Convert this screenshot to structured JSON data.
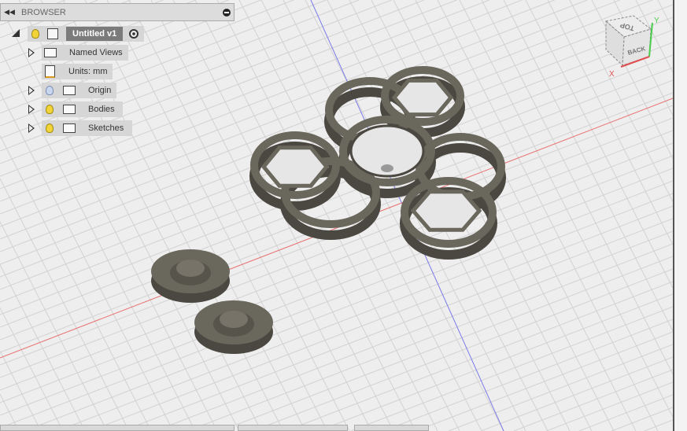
{
  "browser": {
    "title": "BROWSER",
    "root": {
      "label": "Untitled v1"
    },
    "items": [
      {
        "label": "Named Views",
        "icon": "folder-icon",
        "expandable": true
      },
      {
        "label": "Units: mm",
        "icon": "units-document-icon",
        "expandable": false
      },
      {
        "label": "Origin",
        "icon": "folder-icon",
        "visibility": "hidden",
        "expandable": true
      },
      {
        "label": "Bodies",
        "icon": "folder-icon",
        "visibility": "visible",
        "expandable": true
      },
      {
        "label": "Sketches",
        "icon": "folder-icon",
        "visibility": "visible",
        "expandable": true
      }
    ]
  },
  "viewcube": {
    "top": "TOP",
    "back": "BACK",
    "x_axis": "X",
    "y_axis": "Y"
  },
  "colors": {
    "x_axis": "#e05050",
    "y_axis": "#4ccc4c",
    "z_axis": "#6a6ae0",
    "model": "#6a675d"
  }
}
